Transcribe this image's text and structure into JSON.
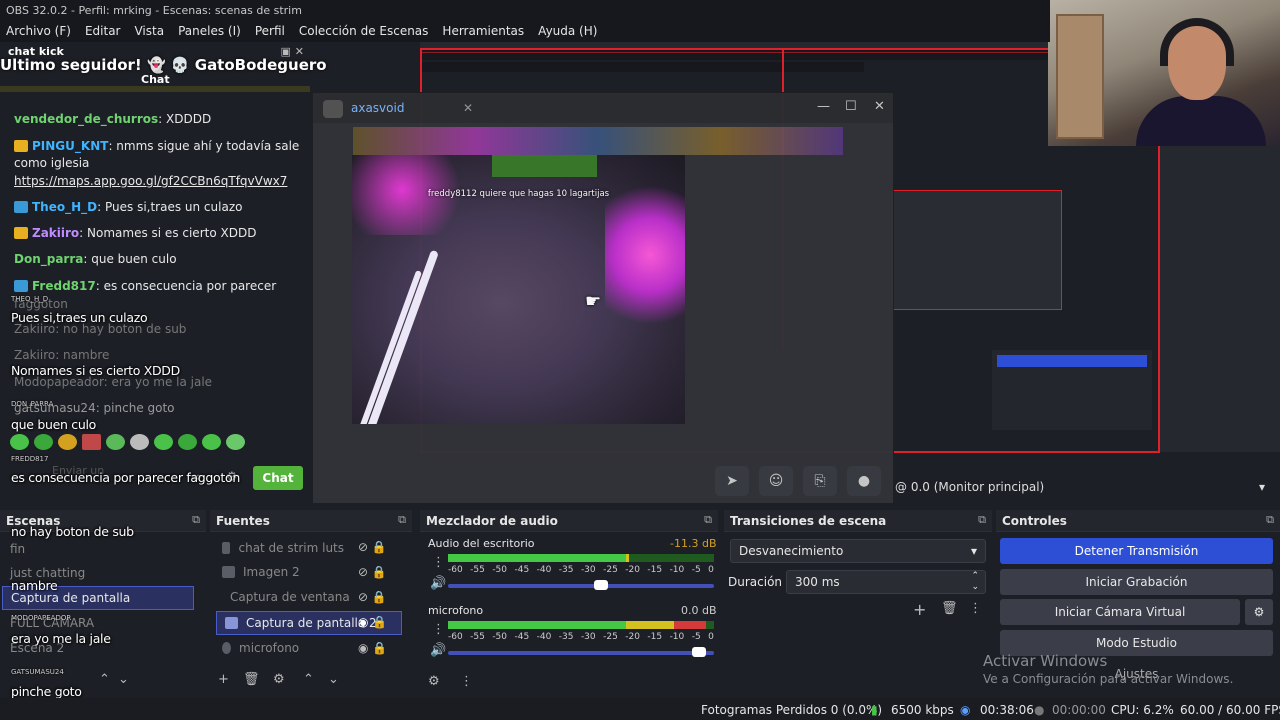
{
  "window": {
    "title": "OBS 32.0.2 - Perfil: mrking - Escenas: scenas de strim"
  },
  "menu": [
    "Archivo (F)",
    "Editar",
    "Vista",
    "Paneles (I)",
    "Perfil",
    "Colección de Escenas",
    "Herramientas",
    "Ayuda (H)"
  ],
  "chat_dock": {
    "title": "chat kick",
    "follower_banner": "Ultimo seguidor! 👻 💀 GatoBodeguero",
    "label": "Chat",
    "messages": [
      {
        "user": "vendedor_de_churros",
        "text": ": XDDDD",
        "color": "#6fd36f"
      },
      {
        "user": "PINGU_KNT",
        "text": ": nmms sigue ahí y todavía sale como iglesia",
        "color": "#3fb4ff"
      },
      {
        "user": "",
        "text": "https://maps.app.goo.gl/gf2CCBn6qTfqvVwx7",
        "color": "#ffffff",
        "link": true
      },
      {
        "user": "Theo_H_D",
        "text": ": Pues si,traes un culazo",
        "color": "#3fb4ff"
      },
      {
        "user": "Zakiiro",
        "text": ": Nomames si es cierto XDDD",
        "color": "#c08bff"
      },
      {
        "user": "Don_parra",
        "text": ": que buen culo",
        "color": "#6fd36f"
      },
      {
        "user": "Fredd817",
        "text": ": es consecuencia por parecer",
        "color": "#6fd36f"
      }
    ],
    "faded": [
      "faggoton",
      "Zakiiro: no hay boton de sub",
      "Zakiiro: nambre",
      "Modopapeador: era yo me la jale",
      "gatsumasu24: pinche goto"
    ],
    "send_placeholder": "Enviar un",
    "chat_button": "Chat"
  },
  "overlay_chat": [
    {
      "user": "THEO_H_D",
      "text": "Pues si,traes un culazo"
    },
    {
      "user": "ZAKIIRO",
      "text": "Nomames si es cierto XDDD"
    },
    {
      "user": "DON_PARRA",
      "text": "que buen culo"
    },
    {
      "user": "FREDD817",
      "text": "es consecuencia por parecer faggoton"
    },
    {
      "user": "ZAKIIRO",
      "text": "no hay boton de sub"
    },
    {
      "user": "ZAKIIRO",
      "text": "nambre"
    },
    {
      "user": "MODOPAPEADOR",
      "text": "era yo me la jale"
    },
    {
      "user": "GATSUMASU24",
      "text": "pinche goto"
    }
  ],
  "discord": {
    "title": "axasvoid",
    "video_caption": "freddy8112 quiere que hagas 10 lagartijas"
  },
  "scenes": {
    "title": "Escenas",
    "items": [
      "fin",
      "just chatting",
      "Captura de pantalla",
      "FULL CAMARA",
      "Escena 2"
    ],
    "selected": 2
  },
  "sources": {
    "title": "Fuentes",
    "items": [
      {
        "name": "chat de strim luts",
        "visible": false
      },
      {
        "name": "Imagen 2",
        "visible": false
      },
      {
        "name": "Captura de ventana",
        "visible": false
      },
      {
        "name": "Captura de pantalla 2",
        "visible": true
      },
      {
        "name": "microfono",
        "visible": true
      }
    ],
    "selected": 3
  },
  "mixer": {
    "title": "Mezclador de audio",
    "channels": [
      {
        "name": "Audio del escritorio",
        "db": "-11.3 dB",
        "level": 0.68,
        "volume": 0.6
      },
      {
        "name": "microfono",
        "db": "0.0 dB",
        "level": 0.97,
        "volume": 0.97
      }
    ],
    "ticks": [
      "-60",
      "-55",
      "-50",
      "-45",
      "-40",
      "-35",
      "-30",
      "-25",
      "-20",
      "-15",
      "-10",
      "-5",
      "0"
    ]
  },
  "transitions": {
    "title": "Transiciones de escena",
    "selected": "Desvanecimiento",
    "duration_label": "Duración",
    "duration": "300 ms"
  },
  "controls": {
    "title": "Controles",
    "buttons": [
      "Detener Transmisión",
      "Iniciar Grabación",
      "Iniciar Cámara Virtual",
      "Modo Estudio",
      "Ajustes"
    ]
  },
  "monitor": "@ 0.0 (Monitor principal)",
  "watermark": {
    "line1": "Activar Windows",
    "line2": "Ve a Configuración para activar Windows."
  },
  "status": {
    "dropped": "Fotogramas Perdidos 0 (0.0%)",
    "bitrate": "6500 kbps",
    "live_time": "00:38:06",
    "rec_time": "00:00:00",
    "cpu": "CPU: 6.2%",
    "fps": "60.00 / 60.00 FPS"
  },
  "colors": {
    "accent": "#2c4fd6",
    "chat_green": "#53b33b",
    "live_red": "#e0202a"
  }
}
